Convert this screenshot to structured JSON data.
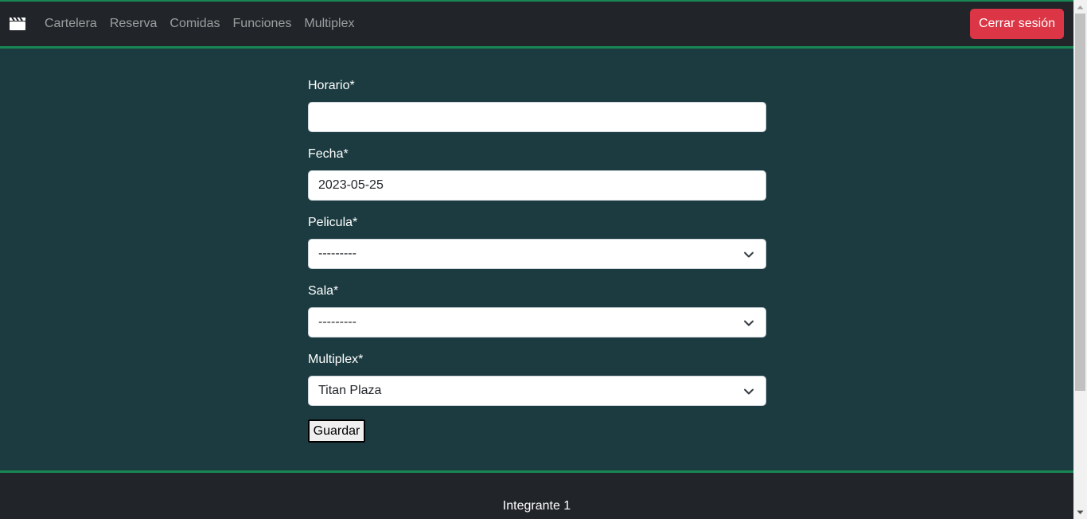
{
  "navbar": {
    "brand_icon": "clapperboard-icon",
    "links": [
      "Cartelera",
      "Reserva",
      "Comidas",
      "Funciones",
      "Multiplex"
    ],
    "logout_label": "Cerrar sesión"
  },
  "form": {
    "horario": {
      "label": "Horario*",
      "value": ""
    },
    "fecha": {
      "label": "Fecha*",
      "value": "2023-05-25"
    },
    "pelicula": {
      "label": "Pelicula*",
      "selected": "---------"
    },
    "sala": {
      "label": "Sala*",
      "selected": "---------"
    },
    "multiplex": {
      "label": "Multiplex*",
      "selected": "Titan Plaza"
    },
    "save_label": "Guardar"
  },
  "footer": {
    "text": "Integrante 1"
  },
  "colors": {
    "page_bg": "#1b3b40",
    "navbar_bg": "#212529",
    "accent_green": "#198754",
    "danger": "#dc3545"
  }
}
